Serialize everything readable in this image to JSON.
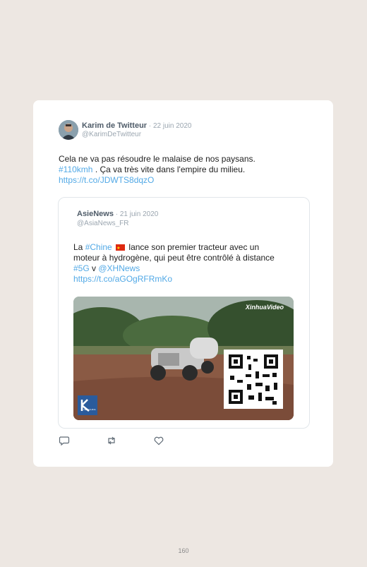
{
  "tweet": {
    "author": "Karim de Twitteur",
    "date": " · 22 juin 2020",
    "handle": "@KarimDeTwitteur",
    "text_line1": "Cela ne va pas résoudre le malaise de nos paysans.",
    "hashtag": "#110kmh",
    "text_line2": " . Ça va très vite dans l'empire du milieu.",
    "link": "https://t.co/JDWTS8dqzO"
  },
  "quoted": {
    "author": "AsieNews",
    "date": " · 21 juin 2020",
    "handle": "@AsiaNews_FR",
    "text_a": "La ",
    "hashtag1": "#Chine",
    "text_b": " lance son premier tracteur avec un moteur à hydrogène, qui peut être contrôlé à distance ",
    "hashtag2": "#5G",
    "text_c": " v ",
    "mention": "@XHNews",
    "link": "https://t.co/aGOgRFRmKo",
    "media": {
      "watermark": "XinhuaVideo",
      "badge_text": "NEW CHINA"
    }
  },
  "actions": {
    "reply_icon": "reply-icon",
    "retweet_icon": "retweet-icon",
    "like_icon": "heart-icon"
  },
  "page_number": "160"
}
